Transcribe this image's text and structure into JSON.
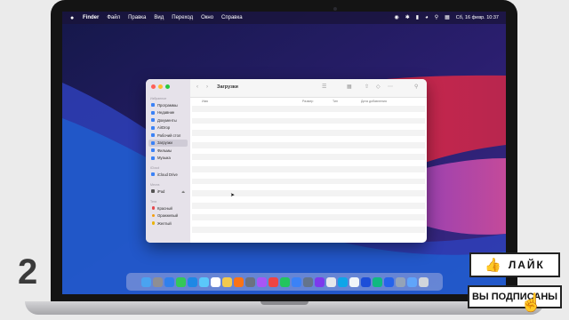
{
  "menubar": {
    "apple": "",
    "items": [
      "Finder",
      "Файл",
      "Правка",
      "Вид",
      "Переход",
      "Окно",
      "Справка"
    ],
    "datetime": "Сб, 16 февр.  10:37",
    "status_icons": [
      "record-icon",
      "bluetooth-icon",
      "battery-icon",
      "wifi-icon",
      "search-icon",
      "control-center-icon",
      "siri-icon"
    ]
  },
  "finder": {
    "title": "Загрузки",
    "sidebar": {
      "favorites_header": "Избранное",
      "favorites": [
        "Программы",
        "Недавние",
        "Документы",
        "AirDrop",
        "Рабочий стол",
        "Загрузки",
        "Фильмы",
        "Музыка"
      ],
      "icloud_header": "iCloud",
      "icloud": [
        "iCloud Drive"
      ],
      "places_header": "Места",
      "places": [
        "iPad"
      ],
      "tags_header": "Теги",
      "tags": [
        {
          "label": "Красный",
          "color": "#e5484d"
        },
        {
          "label": "Оранжевый",
          "color": "#f59e0b"
        },
        {
          "label": "Желтый",
          "color": "#eab308"
        }
      ]
    },
    "columns": [
      "Имя",
      "Размер",
      "Тип",
      "Дата добавления"
    ]
  },
  "overlay": {
    "step_number": "2",
    "like_label": "ЛАЙК",
    "subscribed_label": "ВЫ ПОДПИСАНЫ"
  }
}
